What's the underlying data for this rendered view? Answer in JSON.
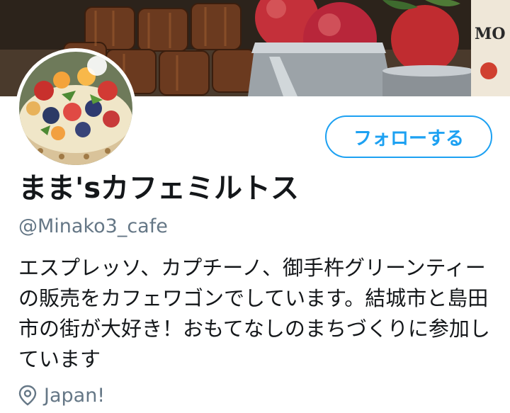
{
  "banner": {
    "image": "cafe-banner-image",
    "bottle_label": "MO"
  },
  "avatar": {
    "image": "fruit-tart-image"
  },
  "follow_button": {
    "label": "フォローする"
  },
  "profile": {
    "display_name": "まま'sカフェミルトス",
    "handle": "@Minako3_cafe",
    "bio": "エスプレッソ、カプチーノ、御手杵グリーンティーの販売をカフェワゴンでしています。結城市と島田市の街が大好き！おもてなしのまちづくりに参加しています",
    "location": "Japan!"
  },
  "icons": {
    "location": "location-pin-icon"
  },
  "colors": {
    "accent": "#1da1f2",
    "text": "#14171a",
    "muted": "#657786"
  }
}
